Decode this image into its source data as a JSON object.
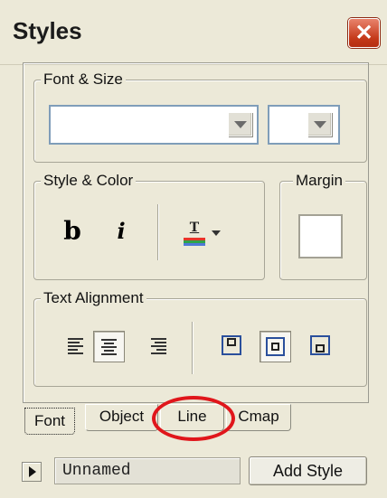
{
  "window": {
    "title": "Styles",
    "close_glyph": "✕"
  },
  "font_size_group": {
    "label": "Font & Size",
    "font_value": "",
    "size_value": ""
  },
  "style_color_group": {
    "label": "Style & Color",
    "bold_glyph": "b",
    "italic_glyph": "i",
    "text_color_glyph": "T"
  },
  "margin_group": {
    "label": "Margin",
    "value": ""
  },
  "text_alignment_group": {
    "label": "Text Alignment"
  },
  "tabs": [
    {
      "label": "Font",
      "active": true
    },
    {
      "label": "Object",
      "active": false
    },
    {
      "label": "Line",
      "active": false,
      "highlighted": true
    },
    {
      "label": "Cmap",
      "active": false
    }
  ],
  "footer": {
    "style_name": "Unnamed",
    "add_style_label": "Add Style"
  },
  "colors": {
    "window_bg": "#ece9d8",
    "close_red": "#c4391a",
    "annotation_red": "#e0161b"
  },
  "icons": [
    "close-icon",
    "dropdown-arrow-icon",
    "bold-icon",
    "italic-icon",
    "text-color-icon",
    "align-left-icon",
    "align-center-icon",
    "align-right-icon",
    "valign-top-icon",
    "valign-middle-icon",
    "valign-bottom-icon",
    "expand-arrow-icon"
  ]
}
